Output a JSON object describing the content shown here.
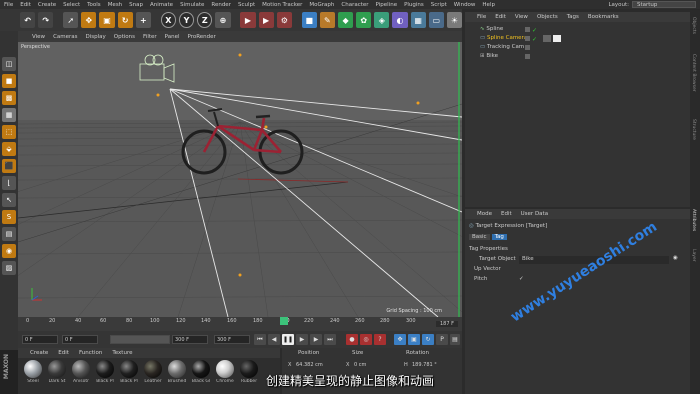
{
  "menubar": {
    "items": [
      "File",
      "Edit",
      "Create",
      "Select",
      "Tools",
      "Mesh",
      "Snap",
      "Animate",
      "Simulate",
      "Render",
      "Sculpt",
      "Motion Tracker",
      "MoGraph",
      "Character",
      "Pipeline",
      "Plugins",
      "Script",
      "Window",
      "Help"
    ],
    "layout_label": "Layout:",
    "layout_value": "Startup"
  },
  "viewport": {
    "menu": [
      "View",
      "Cameras",
      "Display",
      "Options",
      "Filter",
      "Panel",
      "ProRender"
    ],
    "label": "Perspective",
    "grid_spacing": "Grid Spacing : 100 cm"
  },
  "timeline": {
    "ticks": [
      "0",
      "20",
      "40",
      "60",
      "80",
      "100",
      "120",
      "140",
      "160",
      "180",
      "200",
      "220",
      "240",
      "260",
      "280",
      "300"
    ],
    "current_frame": "187 F",
    "start": "0 F",
    "min": "0 F",
    "max": "300 F",
    "end": "300 F"
  },
  "materials": {
    "menu": [
      "Create",
      "Edit",
      "Function",
      "Texture"
    ],
    "items": [
      {
        "name": "Steel",
        "color": "#9aa0a6"
      },
      {
        "name": "Dark St",
        "color": "#3a3a3a"
      },
      {
        "name": "Anisotr",
        "color": "#555555"
      },
      {
        "name": "Black Pl",
        "color": "#1c1c1c"
      },
      {
        "name": "Black Pl",
        "color": "#202020"
      },
      {
        "name": "Leather",
        "color": "#2a2622"
      },
      {
        "name": "Brushed",
        "color": "#6b6b6b"
      },
      {
        "name": "Black Gl",
        "color": "#151515"
      },
      {
        "name": "Chrome",
        "color": "#cfcfcf"
      },
      {
        "name": "Rubber",
        "color": "#1a1a1a"
      }
    ]
  },
  "coordinates": {
    "headers": [
      "Position",
      "Size",
      "Rotation"
    ],
    "x_label": "X",
    "x_pos": "64.382 cm",
    "x_size": "0 cm",
    "h_label": "H",
    "h_rot": "189.781 °"
  },
  "object_manager": {
    "menu": [
      "File",
      "Edit",
      "View",
      "Objects",
      "Tags",
      "Bookmarks"
    ],
    "objects": [
      {
        "name": "Spline",
        "color": "#cfcfcf"
      },
      {
        "name": "Spline Camera",
        "color": "#f0c020"
      },
      {
        "name": "Tracking Cam",
        "color": "#cfcfcf"
      },
      {
        "name": "Bike",
        "color": "#cfcfcf"
      }
    ]
  },
  "attributes": {
    "menu": [
      "Mode",
      "Edit",
      "User Data"
    ],
    "title": "Target Expression [Target]",
    "tabs": [
      "Basic",
      "Tag"
    ],
    "section": "Tag Properties",
    "target_object_label": "Target Object",
    "target_object_value": "Bike",
    "up_vector_label": "Up Vector",
    "pitch_label": "Pitch",
    "pitch_value": "✓"
  },
  "right_tabs": [
    "Objects",
    "Content Browser",
    "Structure",
    "Attributes",
    "Layer"
  ],
  "watermark": "www.yuyueaoshi.com",
  "subtitle": "创建精美呈现的静止图像和动画",
  "brand": "MAXON"
}
